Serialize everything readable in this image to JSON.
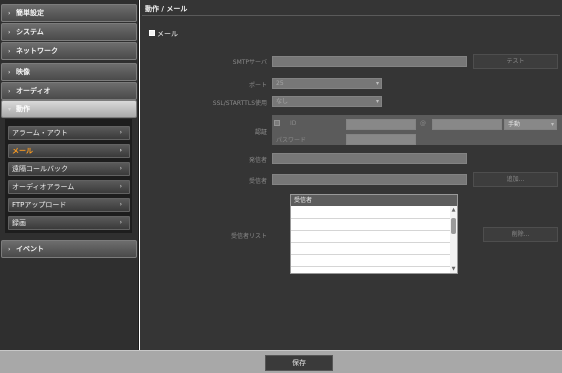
{
  "sidebar": {
    "items": [
      {
        "label": "簡単設定"
      },
      {
        "label": "システム"
      },
      {
        "label": "ネットワーク"
      },
      {
        "label": "映像"
      },
      {
        "label": "オーディオ"
      },
      {
        "label": "動作"
      },
      {
        "label": "イベント"
      }
    ],
    "sub_items": [
      {
        "label": "アラーム・アウト"
      },
      {
        "label": "メール"
      },
      {
        "label": "遠隔コールバック"
      },
      {
        "label": "オーディオアラーム"
      },
      {
        "label": "FTPアップロード"
      },
      {
        "label": "録画"
      }
    ],
    "active_sub": "メール",
    "active_color": "#ff9d1f"
  },
  "main": {
    "title": "動作 / メール",
    "enable_label": "メール",
    "smtp_label": "SMTPサーバ",
    "test_button": "テスト",
    "port_label": "ポート",
    "port_value": "25",
    "ssl_label": "SSL/STARTTLS使用",
    "ssl_value": "なし",
    "auth_label": "認証",
    "auth_id_label": "ID",
    "auth_at": "@",
    "auth_mode_value": "手動",
    "auth_password_label": "パスワード",
    "sender_label": "発信者",
    "recipient_label": "受信者",
    "add_button": "追加...",
    "recipient_list_label": "受信者リスト",
    "recipient_list_header": "受信者",
    "delete_button": "削除..."
  },
  "footer": {
    "save_button": "保存"
  }
}
